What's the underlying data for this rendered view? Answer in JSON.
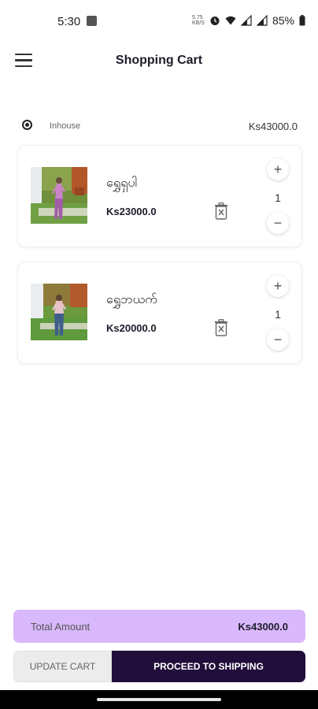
{
  "status_bar": {
    "time": "5:30",
    "speed_top": "5.75",
    "speed_unit": "KB/S",
    "battery": "85%"
  },
  "header": {
    "title": "Shopping Cart"
  },
  "seller": {
    "name": "Inhouse",
    "total": "Ks43000.0",
    "selected": true
  },
  "items": [
    {
      "name": "ရွှေရှပါ",
      "price": "Ks23000.0",
      "quantity": "1",
      "plus": "+",
      "minus": "−"
    },
    {
      "name": "ရွှေဘယက်",
      "price": "Ks20000.0",
      "quantity": "1",
      "plus": "+",
      "minus": "−"
    }
  ],
  "summary": {
    "total_label": "Total Amount",
    "total_value": "Ks43000.0"
  },
  "actions": {
    "update_label": "UPDATE CART",
    "proceed_label": "PROCEED TO SHIPPING"
  },
  "colors": {
    "accent_dark": "#210e3b",
    "accent_light": "#d9b8fb"
  }
}
